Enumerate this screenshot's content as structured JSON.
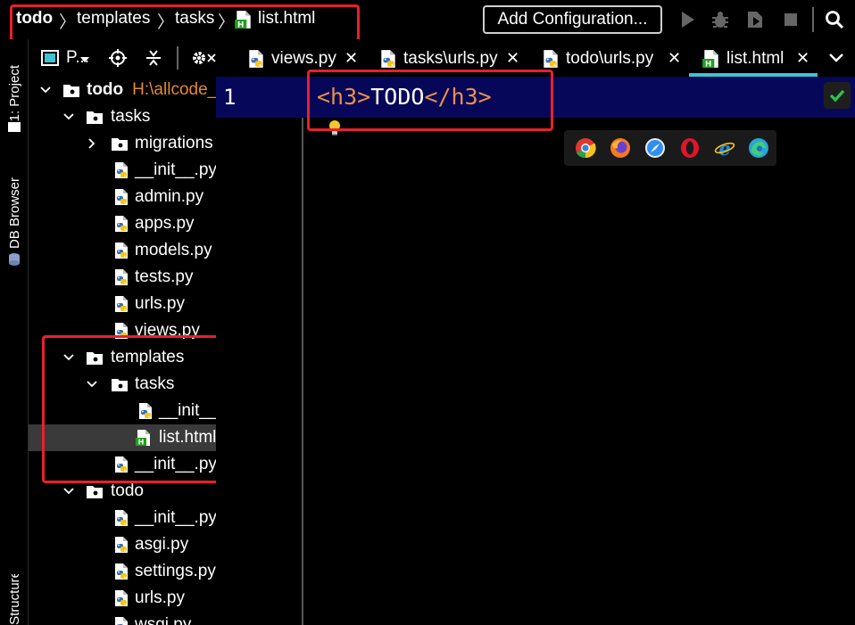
{
  "breadcrumbs": {
    "root": "todo",
    "items": [
      "templates",
      "tasks",
      "list.html"
    ],
    "separator": "〉"
  },
  "toolbar": {
    "add_configuration": "Add Configuration...",
    "icons": [
      "run-icon",
      "debug-icon",
      "coverage-icon",
      "stop-icon",
      "search-icon"
    ]
  },
  "tool_strip": {
    "project_tab": "1: Project",
    "db_browser_tab": "DB Browser",
    "structure_tab": "Structure"
  },
  "project_panel": {
    "title": "P...",
    "icons": [
      "locate-icon",
      "collapse-icon",
      "gear-icon",
      "close-icon"
    ]
  },
  "tree": [
    {
      "label": "todo",
      "sub": "H:\\allcode_",
      "type": "folder",
      "expanded": true
    },
    {
      "label": "tasks",
      "type": "folder",
      "expanded": true
    },
    {
      "label": "migrations",
      "type": "folder",
      "expanded": false
    },
    {
      "label": "__init__.py",
      "type": "python"
    },
    {
      "label": "admin.py",
      "type": "python"
    },
    {
      "label": "apps.py",
      "type": "python"
    },
    {
      "label": "models.py",
      "type": "python"
    },
    {
      "label": "tests.py",
      "type": "python"
    },
    {
      "label": "urls.py",
      "type": "python"
    },
    {
      "label": "views.py",
      "type": "python"
    },
    {
      "label": "templates",
      "type": "folder",
      "expanded": true
    },
    {
      "label": "tasks",
      "type": "folder",
      "expanded": true
    },
    {
      "label": "__init__.py",
      "type": "python"
    },
    {
      "label": "list.html",
      "type": "html",
      "selected": true
    },
    {
      "label": "__init__.py",
      "type": "python"
    },
    {
      "label": "todo",
      "type": "folder",
      "expanded": true
    },
    {
      "label": "__init__.py",
      "type": "python"
    },
    {
      "label": "asgi.py",
      "type": "python"
    },
    {
      "label": "settings.py",
      "type": "python"
    },
    {
      "label": "urls.py",
      "type": "python"
    },
    {
      "label": "wsgi.py",
      "type": "python"
    }
  ],
  "tabs": [
    {
      "label": "views.py",
      "type": "python"
    },
    {
      "label": "tasks\\urls.py",
      "type": "python"
    },
    {
      "label": "todo\\urls.py",
      "type": "python"
    },
    {
      "label": "list.html",
      "type": "html",
      "active": true
    }
  ],
  "editor": {
    "line_number": "1",
    "code": {
      "open_tag": "<h3>",
      "text": "TODO",
      "close_tag": "</h3>"
    }
  },
  "browsers": [
    "chrome-icon",
    "firefox-icon",
    "safari-icon",
    "opera-icon",
    "ie-icon",
    "edge-icon"
  ],
  "colors": {
    "accent": "#3fc3d2",
    "highlight_box": "#e8202a",
    "tag": "#e8904a",
    "line_bg": "#07075a",
    "folder_path": "#e58a2c"
  }
}
